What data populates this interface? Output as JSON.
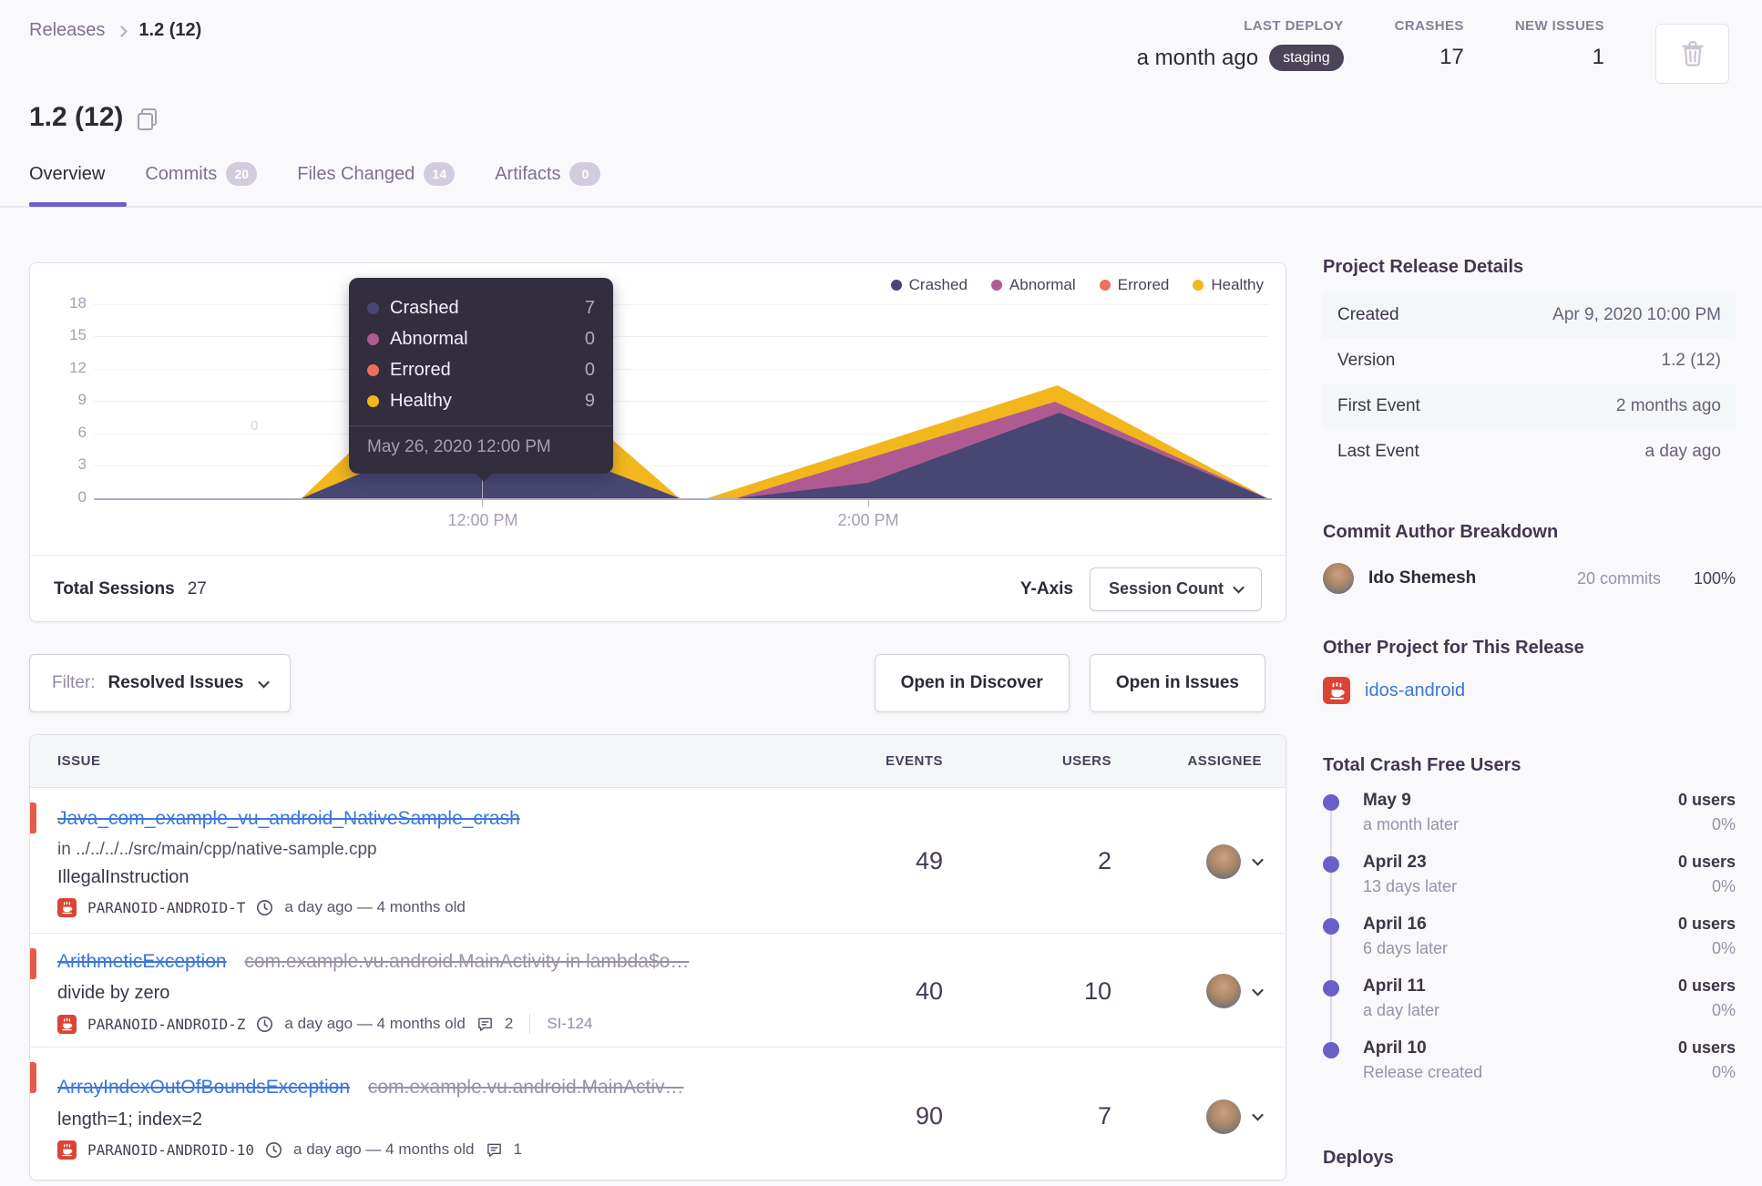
{
  "breadcrumb": {
    "root": "Releases",
    "current": "1.2 (12)"
  },
  "header_stats": {
    "last_deploy": {
      "label": "LAST DEPLOY",
      "value": "a month ago",
      "badge": "staging"
    },
    "crashes": {
      "label": "CRASHES",
      "value": "17"
    },
    "new_issues": {
      "label": "NEW ISSUES",
      "value": "1"
    }
  },
  "title": "1.2 (12)",
  "tabs": {
    "overview": "Overview",
    "commits": "Commits",
    "commits_count": "20",
    "files": "Files Changed",
    "files_count": "14",
    "artifacts": "Artifacts",
    "artifacts_count": "0"
  },
  "chart": {
    "legend": {
      "crashed": "Crashed",
      "abnormal": "Abnormal",
      "errored": "Errored",
      "healthy": "Healthy"
    },
    "tooltip": {
      "rows": [
        {
          "label": "Crashed",
          "value": "7"
        },
        {
          "label": "Abnormal",
          "value": "0"
        },
        {
          "label": "Errored",
          "value": "0"
        },
        {
          "label": "Healthy",
          "value": "9"
        }
      ],
      "date": "May 26, 2020 12:00 PM"
    },
    "y_ticks": [
      "18",
      "15",
      "12",
      "9",
      "6",
      "3",
      "0"
    ],
    "x_ticks": [
      "12:00 PM",
      "2:00 PM"
    ],
    "zero_marker": "0",
    "footer": {
      "total_label": "Total Sessions",
      "total_value": "27",
      "y_axis_label": "Y-Axis",
      "y_axis_value": "Session Count"
    }
  },
  "chart_data": {
    "type": "area",
    "series_names": [
      "Crashed",
      "Abnormal",
      "Errored",
      "Healthy"
    ],
    "colors": {
      "crashed": "#484773",
      "abnormal": "#b05a92",
      "errored": "#ec6f5d",
      "healthy": "#f1b71c"
    },
    "x_ticks": [
      "12:00 PM",
      "2:00 PM"
    ],
    "y_ticks": [
      18,
      15,
      12,
      9,
      6,
      3,
      0
    ],
    "hovered_point": {
      "x": "May 26, 2020 12:00 PM",
      "crashed": 7,
      "abnormal": 0,
      "errored": 0,
      "healthy": 9
    },
    "total_sessions": 27,
    "y_axis": "Session Count",
    "legend_position": "top-right"
  },
  "filter_bar": {
    "filter_label": "Filter:",
    "filter_value": "Resolved Issues",
    "open_discover": "Open in Discover",
    "open_issues": "Open in Issues"
  },
  "issues_table": {
    "headers": {
      "issue": "ISSUE",
      "events": "EVENTS",
      "users": "USERS",
      "assignee": "ASSIGNEE"
    },
    "rows": [
      {
        "title": "Java_com_example_vu_android_NativeSample_crash",
        "culprit": "in ../../../../src/main/cpp/native-sample.cpp",
        "message": "IllegalInstruction",
        "project": "PARANOID-ANDROID-T",
        "age": "a day ago — 4 months old",
        "events": "49",
        "users": "2"
      },
      {
        "title": "ArithmeticException",
        "title_extra": "com.example.vu.android.MainActivity in lambda$o…",
        "message": "divide by zero",
        "project": "PARANOID-ANDROID-Z",
        "age": "a day ago — 4 months old",
        "comments": "2",
        "short_id": "SI-124",
        "events": "40",
        "users": "10"
      },
      {
        "title": "ArrayIndexOutOfBoundsException",
        "title_extra": "com.example.vu.android.MainActiv…",
        "message": "length=1; index=2",
        "project": "PARANOID-ANDROID-10",
        "age": "a day ago — 4 months old",
        "comments": "1",
        "events": "90",
        "users": "7"
      }
    ]
  },
  "sidebar": {
    "release_details": {
      "heading": "Project Release Details",
      "rows": [
        {
          "label": "Created",
          "value": "Apr 9, 2020 10:00 PM"
        },
        {
          "label": "Version",
          "value": "1.2 (12)"
        },
        {
          "label": "First Event",
          "value": "2 months ago"
        },
        {
          "label": "Last Event",
          "value": "a day ago"
        }
      ]
    },
    "commit_authors": {
      "heading": "Commit Author Breakdown",
      "name": "Ido Shemesh",
      "commits": "20 commits",
      "percent": "100%"
    },
    "other_project": {
      "heading": "Other Project for This Release",
      "link": "idos-android"
    },
    "crash_free": {
      "heading": "Total Crash Free Users",
      "items": [
        {
          "date": "May 9",
          "sub": "a month later",
          "users": "0 users",
          "pct": "0%"
        },
        {
          "date": "April 23",
          "sub": "13 days later",
          "users": "0 users",
          "pct": "0%"
        },
        {
          "date": "April 16",
          "sub": "6 days later",
          "users": "0 users",
          "pct": "0%"
        },
        {
          "date": "April 11",
          "sub": "a day later",
          "users": "0 users",
          "pct": "0%"
        },
        {
          "date": "April 10",
          "sub": "Release created",
          "users": "0 users",
          "pct": "0%"
        }
      ]
    },
    "deploys_heading": "Deploys"
  }
}
